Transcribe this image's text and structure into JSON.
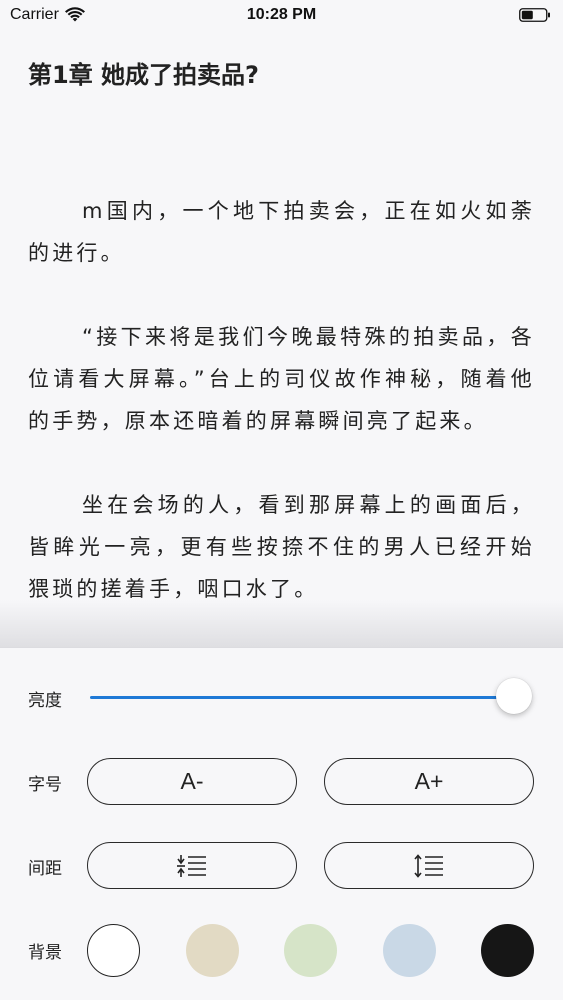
{
  "status_bar": {
    "carrier": "Carrier",
    "time": "10:28 PM"
  },
  "reader": {
    "chapter_title": "第1章 她成了拍卖品?",
    "paragraphs": [
      "m国内，一个地下拍卖会，正在如火如荼的进行。",
      "“接下来将是我们今晚最特殊的拍卖品，各位请看大屏幕。”台上的司仪故作神秘，随着他的手势，原本还暗着的屏幕瞬间亮了起来。",
      "坐在会场的人，看到那屏幕上的画面后，皆眸光一亮，更有些按捺不住的男人已经开始猥琐的搓着手，咽口水了。"
    ]
  },
  "settings": {
    "brightness": {
      "label": "亮度",
      "value": 1.0
    },
    "font_size": {
      "label": "字号",
      "decrease_label": "A-",
      "increase_label": "A+"
    },
    "spacing": {
      "label": "间距",
      "decrease_icon": "line-spacing-decrease-icon",
      "increase_icon": "line-spacing-increase-icon"
    },
    "background": {
      "label": "背景",
      "swatches": [
        {
          "name": "white",
          "color": "#ffffff",
          "selected": true
        },
        {
          "name": "beige",
          "color": "#e2dac4"
        },
        {
          "name": "green",
          "color": "#d6e4c8"
        },
        {
          "name": "blue",
          "color": "#c9d8e6"
        },
        {
          "name": "black",
          "color": "#161616"
        }
      ]
    }
  },
  "colors": {
    "slider_fill": "#1f79d6",
    "panel_bg": "#f7f7f9"
  }
}
